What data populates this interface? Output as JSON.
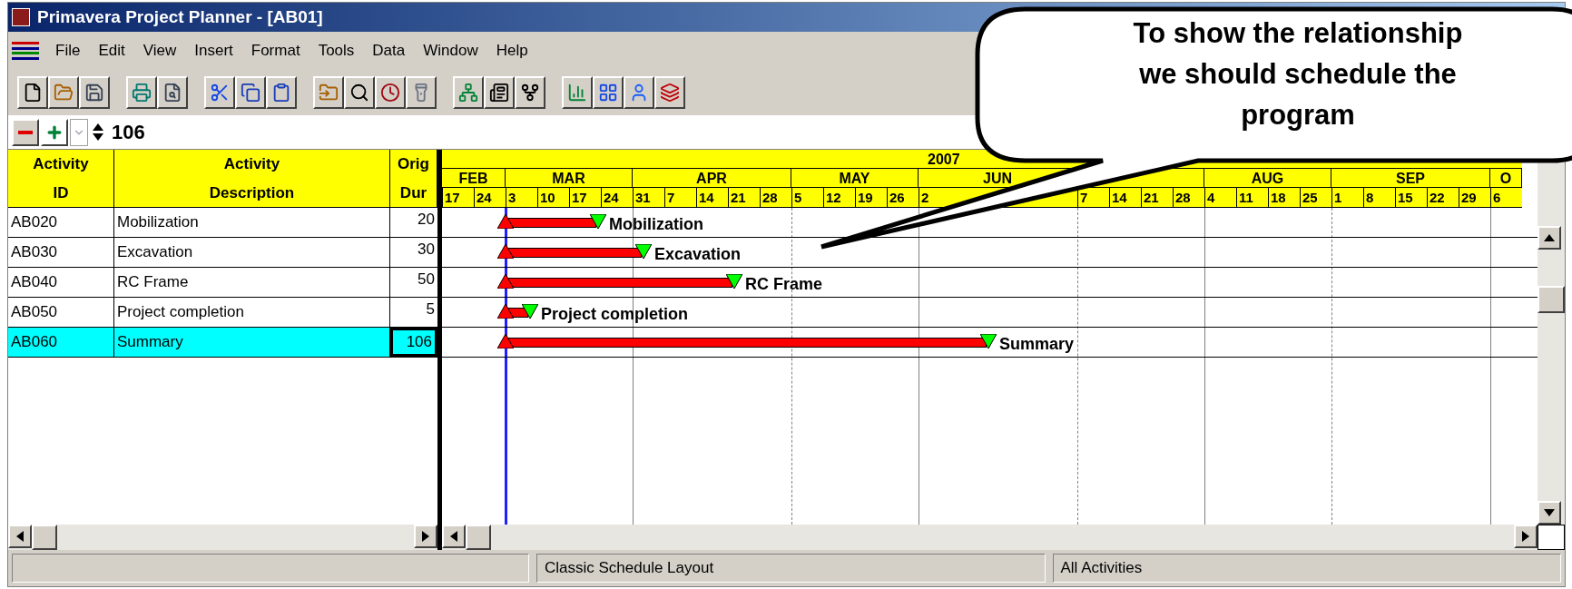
{
  "window": {
    "title": "Primavera Project Planner - [AB01]"
  },
  "menu": [
    "File",
    "Edit",
    "View",
    "Insert",
    "Format",
    "Tools",
    "Data",
    "Window",
    "Help"
  ],
  "edit_bar": {
    "value": "106"
  },
  "table": {
    "columns": [
      [
        "Activity",
        "ID"
      ],
      [
        "Activity",
        "Description"
      ],
      [
        "Orig",
        "Dur"
      ]
    ],
    "rows": [
      {
        "id": "AB020",
        "description": "Mobilization",
        "dur": "20",
        "label": "Mobilization",
        "selected": false
      },
      {
        "id": "AB030",
        "description": "Excavation",
        "dur": "30",
        "label": "Excavation",
        "selected": false
      },
      {
        "id": "AB040",
        "description": "RC Frame",
        "dur": "50",
        "label": "RC Frame",
        "selected": false
      },
      {
        "id": "AB050",
        "description": "Project completion",
        "dur": "5",
        "label": "Project completion",
        "selected": false
      },
      {
        "id": "AB060",
        "description": "Summary",
        "dur": "106",
        "label": "Summary",
        "selected": true
      }
    ]
  },
  "timescale": {
    "year": "2007",
    "months": [
      {
        "label": "FEB",
        "weeks": [
          "17",
          "24"
        ]
      },
      {
        "label": "MAR",
        "weeks": [
          "3",
          "10",
          "17",
          "24"
        ]
      },
      {
        "label": "APR",
        "weeks": [
          "31",
          "7",
          "14",
          "21",
          "28"
        ]
      },
      {
        "label": "MAY",
        "weeks": [
          "5",
          "12",
          "19",
          "26"
        ]
      },
      {
        "label": "JUN",
        "weeks": [
          "2"
        ]
      },
      {
        "weeks": [
          "7",
          "14",
          "21",
          "28"
        ]
      },
      {
        "label": "AUG",
        "weeks": [
          "4",
          "11",
          "18",
          "25"
        ]
      },
      {
        "label": "SEP",
        "weeks": [
          "1",
          "8",
          "15",
          "22",
          "29"
        ]
      },
      {
        "label": "O",
        "weeks": [
          "6"
        ]
      }
    ]
  },
  "status_bar": [
    "Classic Schedule Layout",
    "All Activities"
  ],
  "callout": {
    "text": "To show the relationship we should schedule the program"
  }
}
